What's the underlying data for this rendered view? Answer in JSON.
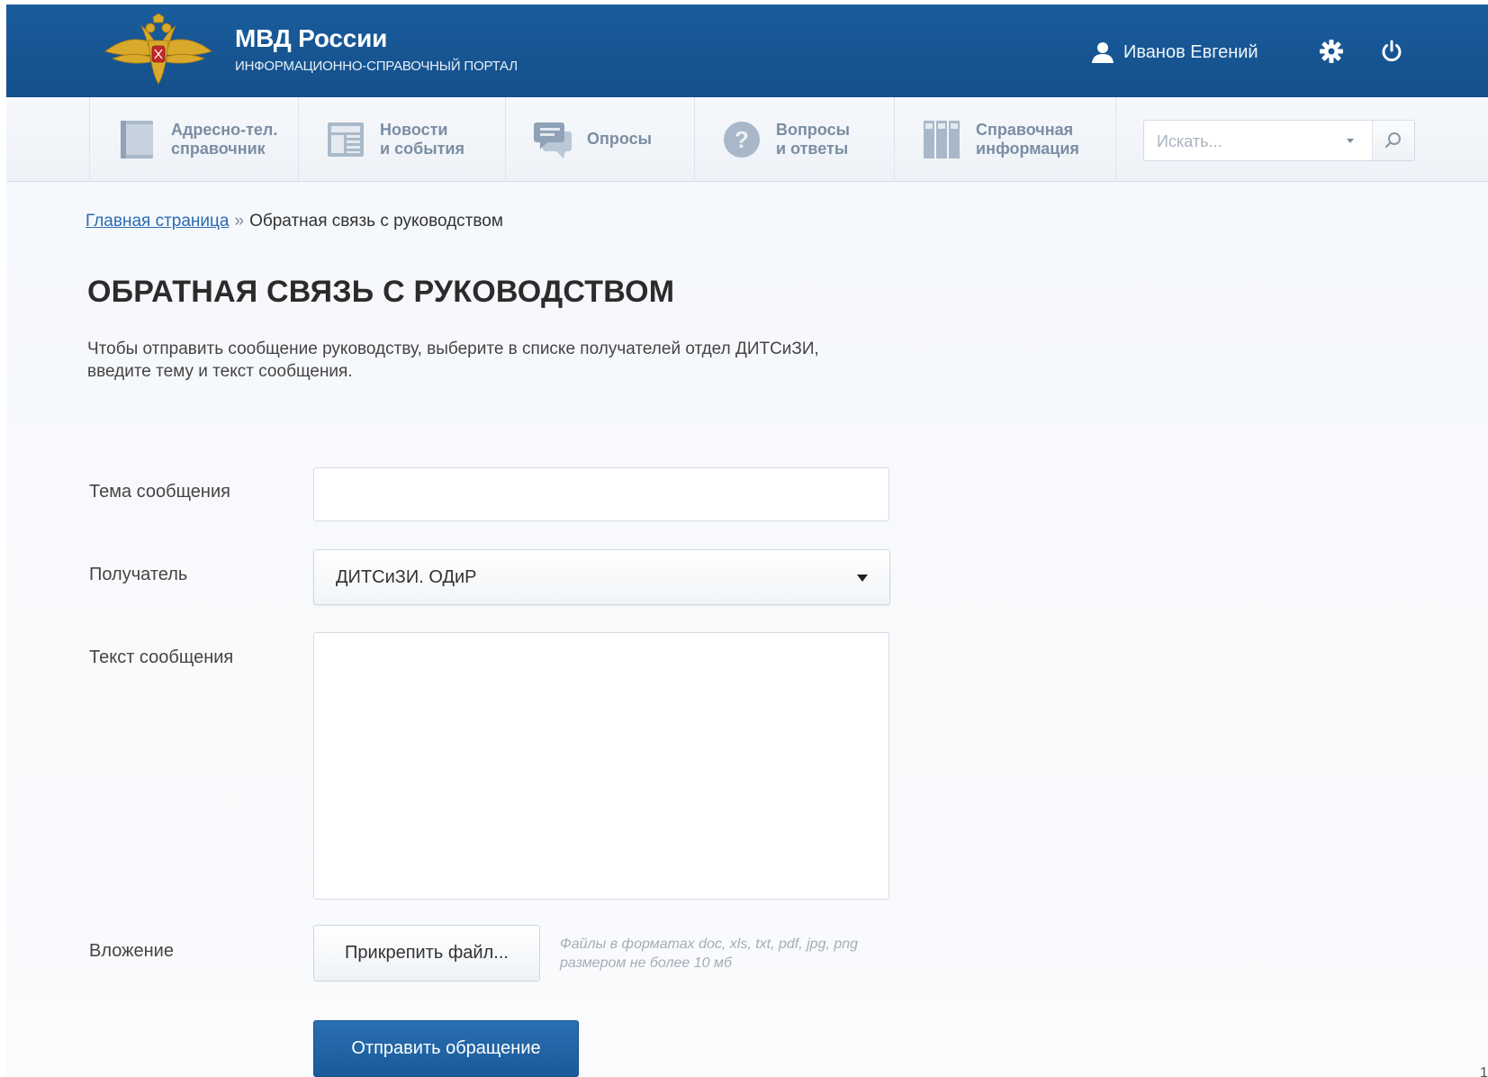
{
  "header": {
    "title": "МВД России",
    "subtitle": "ИНФОРМАЦИОННО-СПРАВОЧНЫЙ ПОРТАЛ",
    "emblem_icon": "eagle-emblem-icon",
    "user_name": "Иванов Евгений",
    "user_icon": "user-icon",
    "settings_icon": "gear-icon",
    "logout_icon": "power-icon"
  },
  "nav": {
    "items": [
      {
        "label": "Адресно-тел.\nсправочник",
        "icon": "phonebook-icon"
      },
      {
        "label": "Новости\nи события",
        "icon": "news-icon"
      },
      {
        "label": "Опросы",
        "icon": "poll-icon"
      },
      {
        "label": "Вопросы\nи ответы",
        "icon": "question-icon"
      },
      {
        "label": "Справочная\nинформация",
        "icon": "reference-icon"
      }
    ],
    "search": {
      "placeholder": "Искать...",
      "icon": "search-icon"
    }
  },
  "breadcrumb": {
    "home": "Главная страница",
    "separator": "»",
    "current": "Обратная связь с руководством"
  },
  "page": {
    "title": "ОБРАТНАЯ СВЯЗЬ С РУКОВОДСТВОМ",
    "intro": "Чтобы отправить сообщение руководству, выберите в списке получателей отдел ДИТСиЗИ, введите тему и текст сообщения."
  },
  "form": {
    "subject_label": "Тема сообщения",
    "subject_value": "",
    "recipient_label": "Получатель",
    "recipient_value": "ДИТСиЗИ. ОДиР",
    "message_label": "Текст сообщения",
    "message_value": "",
    "attachment_label": "Вложение",
    "attach_button": "Прикрепить файл...",
    "attach_hint": "Файлы в форматах doc, xls, txt, pdf, jpg, png размером не более 10 мб",
    "submit_button": "Отправить обращение"
  },
  "page_number": "1",
  "colors": {
    "header_bg": "#14508b",
    "accent": "#2a6cb0",
    "submit_bg": "#1f63a5"
  }
}
